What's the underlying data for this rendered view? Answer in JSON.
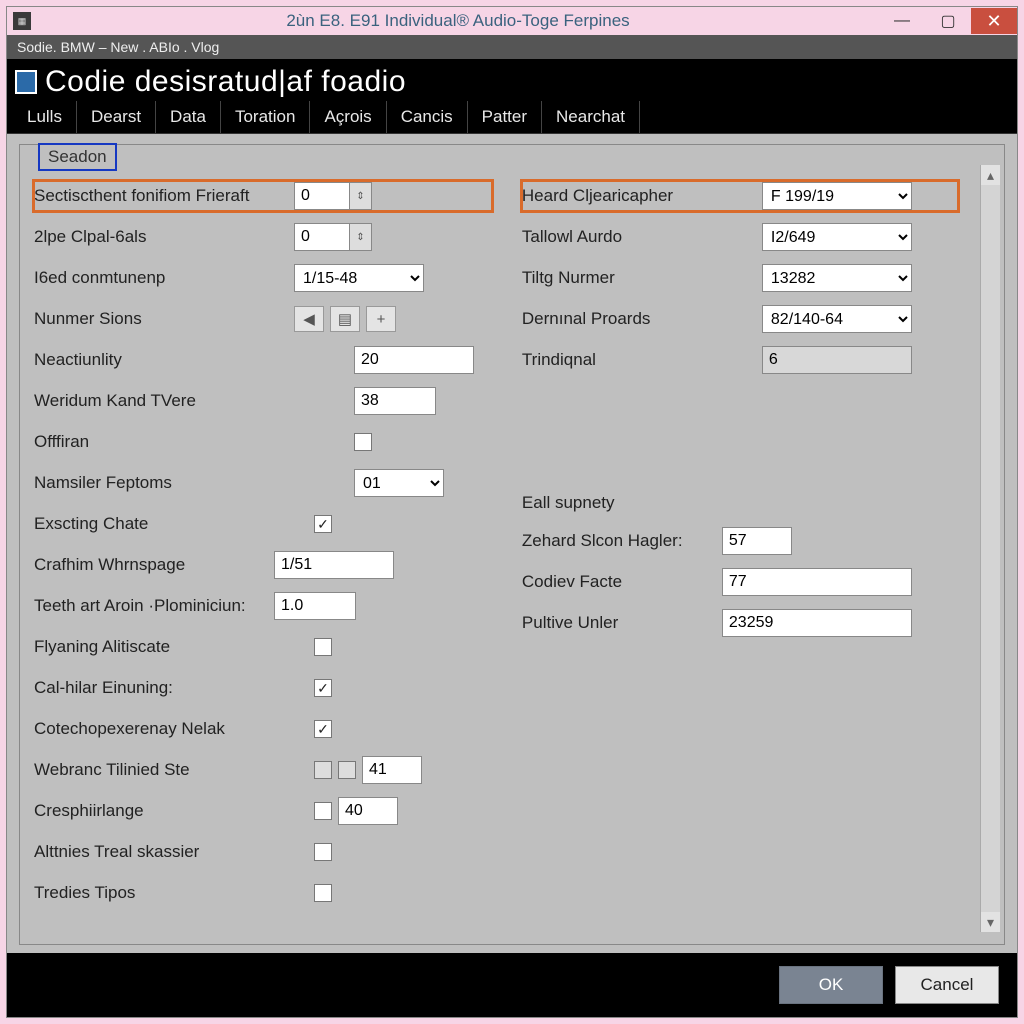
{
  "titlebar": {
    "title": "2ùn E8. E91 Individual® Audio-Toge Ferpines"
  },
  "breadcrumb": "Sodie. BMW  –  New .  ABIo . Vlog",
  "main_title": "Codie desisratud|af foadio",
  "tabs": [
    "Lulls",
    "Dearst",
    "Data",
    "Toration",
    "Açrois",
    "Cancis",
    "Patter",
    "Nearchat"
  ],
  "group_legend": "Seadon",
  "left": {
    "r1": {
      "label": "Sectiscthent fonifiom Frieraft",
      "value": "0"
    },
    "r2": {
      "label": "2lpe Clpal-6als",
      "value": "0"
    },
    "r3": {
      "label": "I6ed conmtunenp",
      "value": "1/15-48"
    },
    "r4": {
      "label": "Nunmer Sions"
    },
    "r5": {
      "label": "Neactiunlity",
      "value": "20"
    },
    "r6": {
      "label": "Weridum Kand TVere",
      "value": "38"
    },
    "r7": {
      "label": "Offfiran"
    },
    "r8": {
      "label": "Namsiler Feptoms",
      "value": "01"
    },
    "r9": {
      "label": "Exscting Chate"
    },
    "r10": {
      "label": "Crafhim Whrnspage",
      "value": "1/51"
    },
    "r11": {
      "label": "Teeth art Aroin ·Plominiciun:",
      "value": "1.0"
    },
    "r12": {
      "label": "Flyaning Alitiscate"
    },
    "r13": {
      "label": "Cal-hilar Einuning:"
    },
    "r14": {
      "label": "Cotechopexerenay Nelak"
    },
    "r15": {
      "label": "Webranc Tilinied Ste",
      "value": "41"
    },
    "r16": {
      "label": "Cresphiirlange",
      "value": "40"
    },
    "r17": {
      "label": "Alttnies Treal skassier"
    },
    "r18": {
      "label": "Tredies Tipos"
    }
  },
  "right": {
    "r1": {
      "label": "Heard Cljearicapher",
      "value": "F 199/19"
    },
    "r2": {
      "label": "Tallowl Aurdo",
      "value": "I2/649"
    },
    "r3": {
      "label": "Tiltg Nurmer",
      "value": "13282"
    },
    "r4": {
      "label": "Dernınal Proards",
      "value": "82/140-64"
    },
    "r5": {
      "label": "Trindiqnal",
      "value": "6"
    },
    "sub": "Eall supnety",
    "r6": {
      "label": "Zehard Slcon Hagler:",
      "value": "57"
    },
    "r7": {
      "label": "Codiev Facte",
      "value": "77"
    },
    "r8": {
      "label": "Pultive Unler",
      "value": "23259"
    }
  },
  "footer": {
    "ok": "OK",
    "cancel": "Cancel"
  }
}
